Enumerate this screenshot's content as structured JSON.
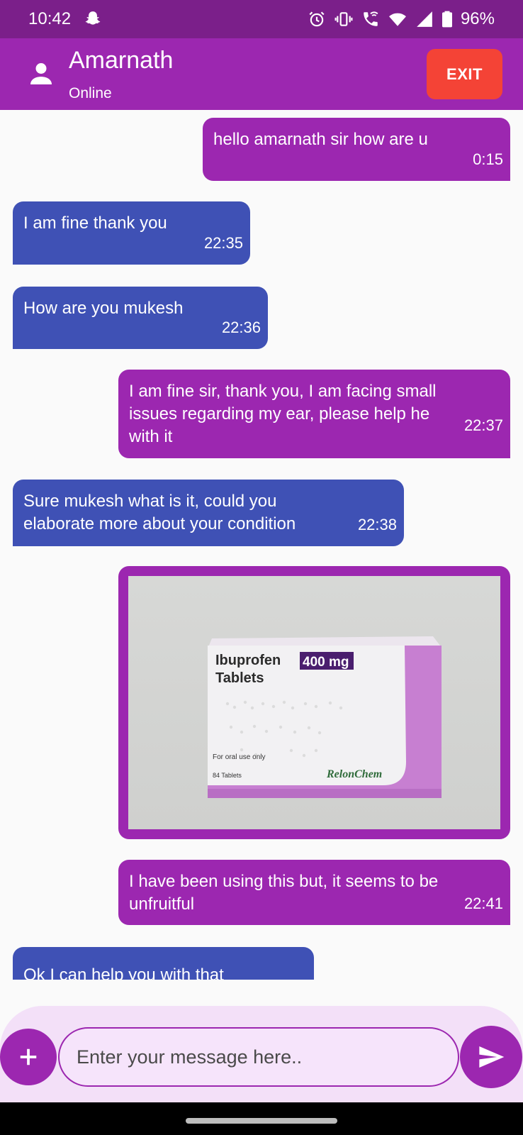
{
  "status_bar": {
    "time": "10:42",
    "battery": "96%",
    "icons": [
      "snapchat-icon",
      "alarm-icon",
      "vibrate-icon",
      "wifi-call-icon",
      "wifi-icon",
      "signal-icon",
      "battery-icon"
    ]
  },
  "header": {
    "name": "Amarnath",
    "status": "Online",
    "exit_label": "EXIT",
    "colors": {
      "bar": "#9c27b0",
      "exit": "#f44336"
    }
  },
  "messages": [
    {
      "direction": "out",
      "text": "hello amarnath sir how are u",
      "time": "0:15"
    },
    {
      "direction": "in",
      "text": "I am fine thank you",
      "time": "22:35"
    },
    {
      "direction": "in",
      "text": "How are you mukesh",
      "time": "22:36"
    },
    {
      "direction": "out",
      "text": "I am fine sir, thank you, I am facing small issues regarding my ear, please help he with it",
      "time": "22:37"
    },
    {
      "direction": "in",
      "text": "Sure mukesh what is it, could you elaborate more about your condition",
      "time": "22:38"
    },
    {
      "direction": "out",
      "type": "image",
      "image_text": {
        "product": "Ibuprofen",
        "dose": "400 mg",
        "form": "Tablets",
        "usage": "For oral use only",
        "count": "84 Tablets",
        "brand": "RelonChem"
      }
    },
    {
      "direction": "out",
      "text": "I have been using this but, it seems to be unfruitful",
      "time": "22:41"
    },
    {
      "direction": "in",
      "text": "Ok I can help you with that",
      "time": ""
    }
  ],
  "composer": {
    "placeholder": "Enter your message here..",
    "add_icon": "plus-icon",
    "send_icon": "send-icon"
  },
  "colors": {
    "outgoing": "#9c27b0",
    "incoming": "#3f51b5",
    "composer_bg": "#f3e0f8"
  }
}
